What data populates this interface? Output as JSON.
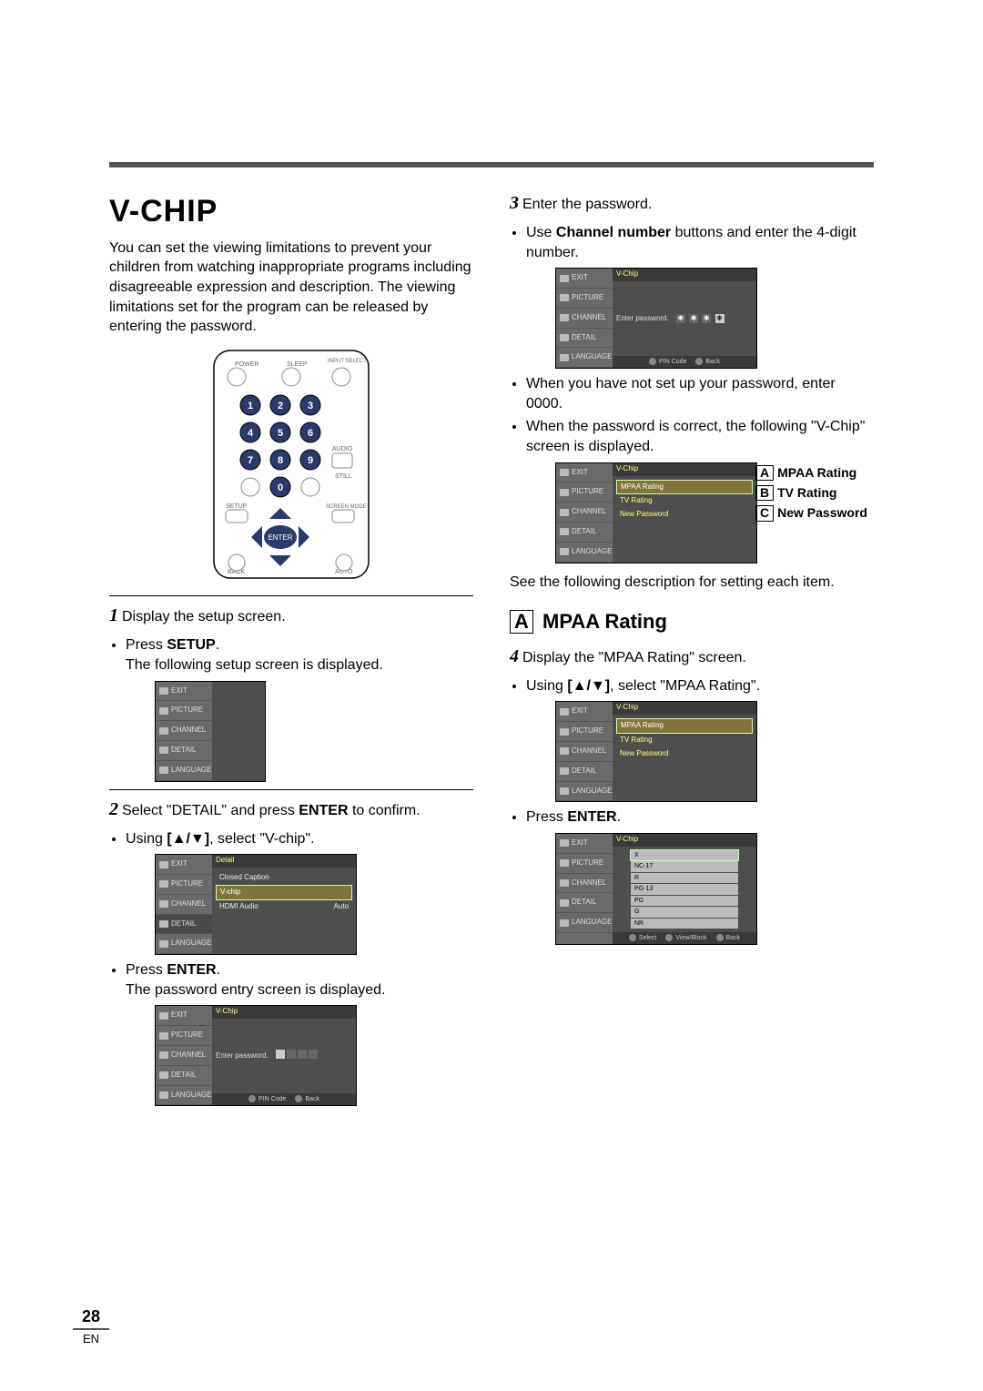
{
  "page": {
    "number": "28",
    "lang": "EN"
  },
  "section": {
    "title": "V-CHIP",
    "intro": "You can set the viewing limitations to prevent your children from watching inappropriate programs including disagreeable expression and description. The viewing limitations set for the program can be released by entering the password."
  },
  "remote": {
    "labels": {
      "power": "POWER",
      "sleep": "SLEEP",
      "input": "INPUT SELECT",
      "audio": "AUDIO",
      "still": "STILL",
      "setup": "SETUP",
      "screen": "SCREEN MODE",
      "enter": "ENTER",
      "back": "BACK",
      "auto": "AUTO"
    },
    "digits": [
      "1",
      "2",
      "3",
      "4",
      "5",
      "6",
      "7",
      "8",
      "9",
      "0"
    ]
  },
  "step1": {
    "lead": "Display the setup screen.",
    "b1_pre": "Press ",
    "b1_bold": "SETUP",
    "b1_post": ".",
    "note": "The following setup screen is displayed."
  },
  "osd_tabs": {
    "exit": "EXIT",
    "picture": "PICTURE",
    "channel": "CHANNEL",
    "detail": "DETAIL",
    "language": "LANGUAGE"
  },
  "step2": {
    "lead_pre": "Select \"DETAIL\" and press ",
    "lead_bold": "ENTER",
    "lead_post": " to confirm.",
    "b1_pre": "Using ",
    "b1_bold": "[▲/▼]",
    "b1_post": ", select \"V-chip\".",
    "detail_title": "Detail",
    "detail_rows": {
      "cc": "Closed Caption",
      "vchip": "V-chip",
      "hdmi": "HDMI Audio",
      "hdmi_val": "Auto"
    },
    "b2_pre": "Press ",
    "b2_bold": "ENTER",
    "b2_post": ".",
    "note2": "The password entry screen is displayed.",
    "pwd_title": "V-Chip",
    "pwd_label": "Enter password.",
    "footer_pin": "PIN Code",
    "footer_back": "Back"
  },
  "step3": {
    "lead": "Enter the password.",
    "b1_pre": "Use ",
    "b1_bold": "Channel number",
    "b1_post": " buttons and enter the 4-digit number.",
    "pwd_title": "V-Chip",
    "pwd_label": "Enter password.",
    "star": "✱",
    "note_a": "When you have not set up your password, enter 0000.",
    "note_b": "When the password is correct, the following \"V-Chip\" screen is displayed.",
    "menu_title": "V-Chip",
    "menu_rows": {
      "mpaa": "MPAA Rating",
      "tv": "TV Rating",
      "newpw": "New Password"
    },
    "call_a": "MPAA Rating",
    "call_b": "TV Rating",
    "call_c": "New Password",
    "endnote": "See the following description for setting each item."
  },
  "sectA": {
    "title": "MPAA Rating",
    "box": "A"
  },
  "step4": {
    "lead": "Display the \"MPAA Rating\" screen.",
    "b1_pre": "Using ",
    "b1_bold": "[▲/▼]",
    "b1_post": ", select \"MPAA Rating\".",
    "menu_title": "V-Chip",
    "b2_pre": "Press ",
    "b2_bold": "ENTER",
    "b2_post": ".",
    "ratings_title": "V-Chip",
    "ratings": [
      "X",
      "NC-17",
      "R",
      "PG-13",
      "PG",
      "G",
      "NR"
    ],
    "footer_select": "Select",
    "footer_view": "View/Block",
    "footer_back": "Back"
  }
}
